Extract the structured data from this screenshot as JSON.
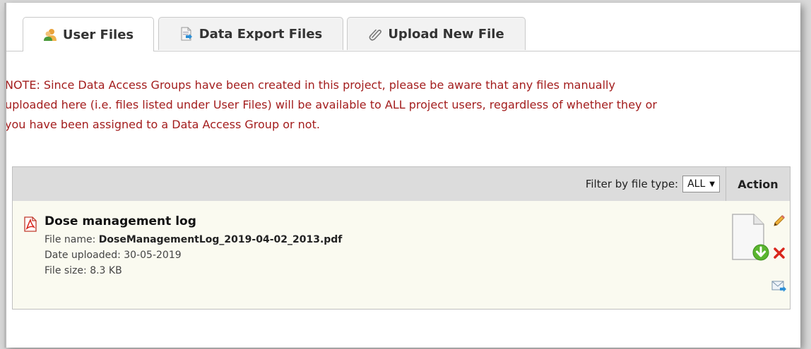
{
  "tabs": [
    {
      "label": "User Files",
      "icon": "users-icon",
      "active": true
    },
    {
      "label": "Data Export Files",
      "icon": "export-file-icon",
      "active": false
    },
    {
      "label": "Upload New File",
      "icon": "paperclip-icon",
      "active": false
    }
  ],
  "note": {
    "line1": "NOTE: Since Data Access Groups have been created in this project, please be aware that any files manually",
    "line2": "uploaded here (i.e. files listed under User Files) will be available to ALL project users, regardless of whether they or",
    "line3": "you have been assigned to a Data Access Group or not."
  },
  "table": {
    "filter_label": "Filter by file type:",
    "filter_value": "ALL",
    "action_header": "Action",
    "file": {
      "title": "Dose management log",
      "file_name_label": "File name:",
      "file_name": "DoseManagementLog_2019-04-02_2013.pdf",
      "date_label": "Date uploaded:",
      "date": "30-05-2019",
      "size_label": "File size:",
      "size": "8.3 KB"
    }
  },
  "colors": {
    "note_text": "#a31d1d",
    "header_bg": "#dcdcdc",
    "row_bg": "#fafaf0",
    "download_green": "#5ab52f",
    "delete_red": "#d9261c"
  }
}
